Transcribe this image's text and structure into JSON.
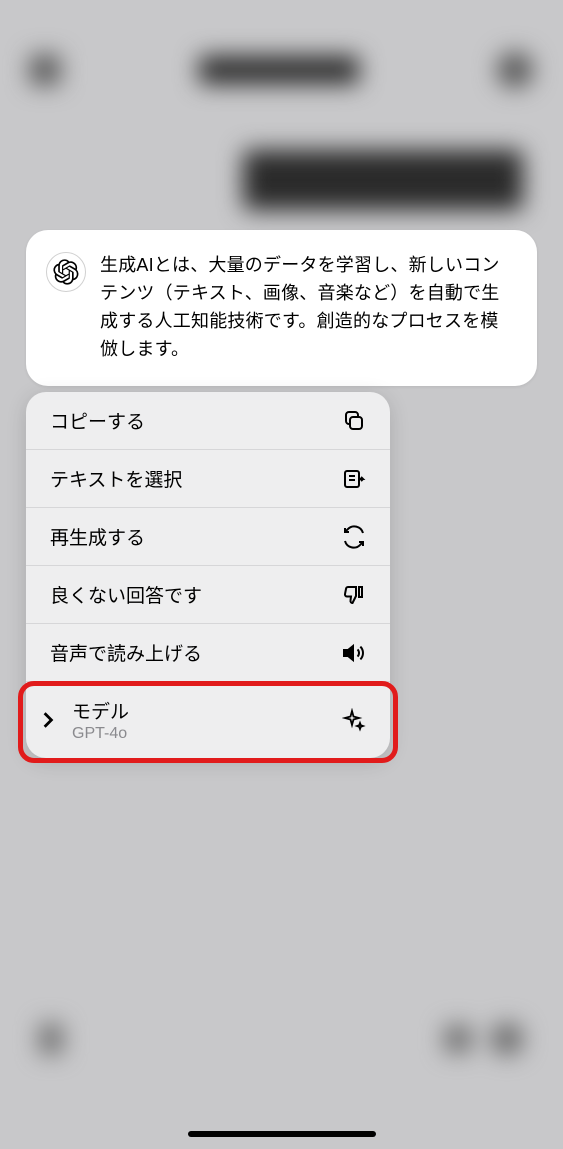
{
  "message": {
    "text": "生成AIとは、大量のデータを学習し、新しいコンテンツ（テキスト、画像、音楽など）を自動で生成する人工知能技術です。創造的なプロセスを模倣します。"
  },
  "menu": {
    "copy": "コピーする",
    "select_text": "テキストを選択",
    "regenerate": "再生成する",
    "bad_response": "良くない回答です",
    "read_aloud": "音声で読み上げる",
    "model_label": "モデル",
    "model_value": "GPT-4o"
  }
}
